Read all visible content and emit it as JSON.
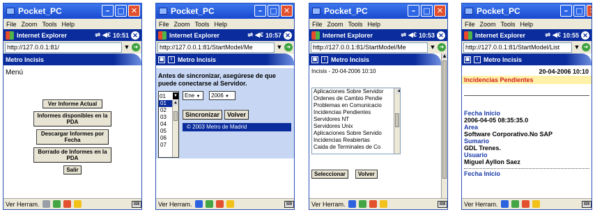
{
  "common": {
    "window_title": "Pocket_PC",
    "menu": [
      "File",
      "Zoom",
      "Tools",
      "Help"
    ],
    "browser_name": "Internet Explorer",
    "status_label": "Ver Herram.",
    "close_glyph": "✕",
    "banner_title": "Metro Incisis"
  },
  "screens": [
    {
      "time": "10:51",
      "url": "http://127.0.0.1:81/",
      "menu_title": "Menú",
      "buttons": [
        "Ver Informe Actual",
        "Informes disponibles en la PDA",
        "Descargar Informes por Fecha",
        "Borrado de Informes en la PDA",
        "Salir"
      ]
    },
    {
      "time": "10:57",
      "url": "http://127.0.0.1:81/StartModel/Me",
      "instruction": "Antes de sincronizar, asegúrese de que puede conectarse al Servidor.",
      "day_value": "01",
      "month_value": "Ene",
      "year_value": "2006",
      "day_options": [
        "01",
        "02",
        "03",
        "04",
        "05",
        "06",
        "07"
      ],
      "sync_button": "Sincronizar",
      "back_button": "Volver",
      "copyright": "© 2003 Metro de Madrid"
    },
    {
      "time": "10:53",
      "url": "http://127.0.0.1:81/StartModel/Me",
      "heading": "Incisis - 20-04-2006 10:10",
      "items": [
        "Aplicaciones Sobre Servidor",
        "Ordenes de Cambio Pendie",
        "Problemas en Comunicacio",
        "Incidencias Pendientes",
        "Servidores NT",
        "Servidores Unix",
        "Aplicaciones Sobre Servido",
        "Incidencias Reabiertas",
        "Caida de Terminales de Co"
      ],
      "select_button": "Seleccionar",
      "back_button": "Volver"
    },
    {
      "time": "10:55",
      "url": "http://127.0.0.1:81/StartModel/List",
      "date": "20-04-2006 10:10",
      "section_title": "Incidencias Pendientes",
      "fields": [
        {
          "label": "Fecha Inicio",
          "value": "2006-04-05 08:35:35.0"
        },
        {
          "label": "Area",
          "value": "Software Corporativo.No SAP"
        },
        {
          "label": "Sumario",
          "value": "GDL Trenes."
        },
        {
          "label": "Usuario",
          "value": "Miguel Ayllon Saez"
        },
        {
          "label": "Fecha Inicio",
          "value": ""
        }
      ]
    }
  ]
}
